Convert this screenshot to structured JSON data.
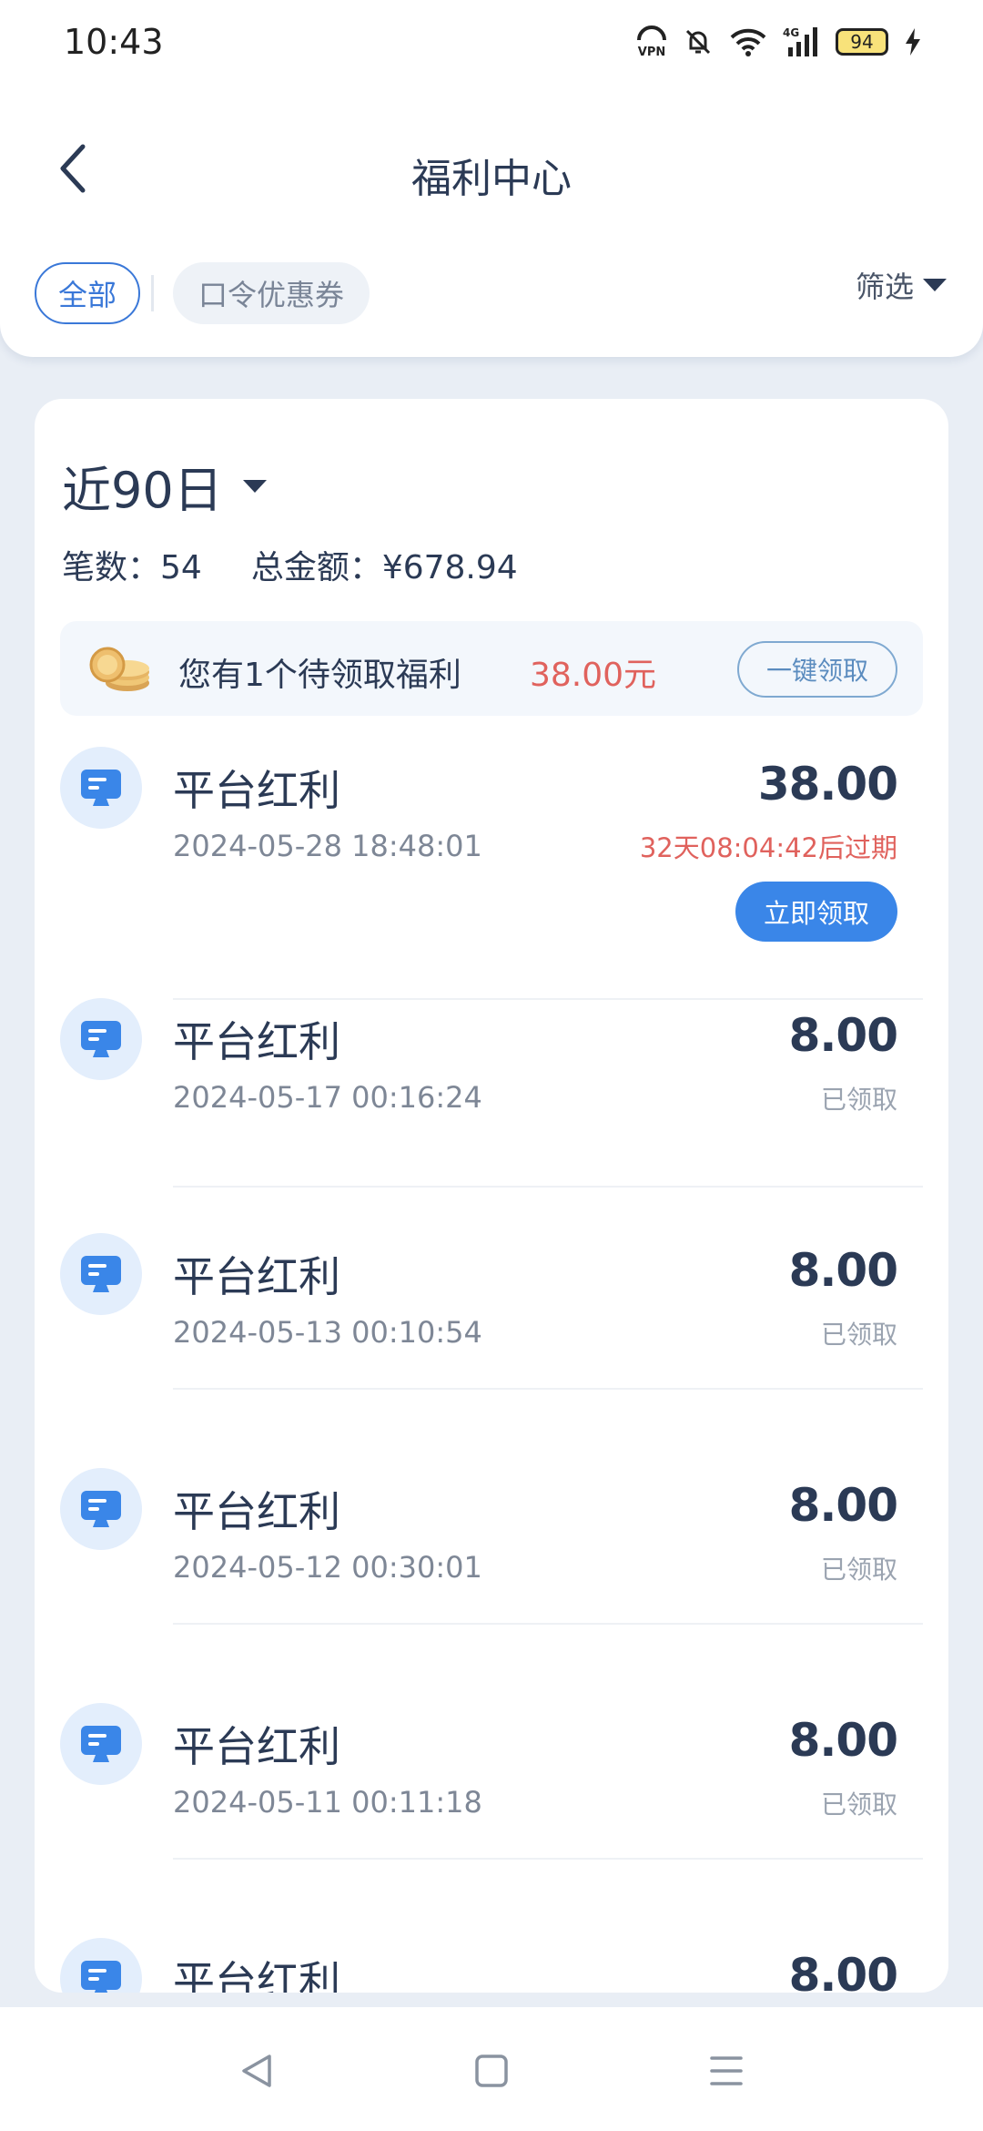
{
  "status_bar": {
    "time": "10:43",
    "battery": "94",
    "network": "4G",
    "icons": [
      "vpn-icon",
      "bell-off-icon",
      "wifi-icon",
      "signal-icon",
      "battery-icon",
      "charging-icon"
    ]
  },
  "header": {
    "title": "福利中心",
    "back_icon": "chevron-left-icon"
  },
  "filters": {
    "chips": [
      "全部",
      "口令优惠券"
    ],
    "active_chip": "全部",
    "filter_label": "筛选"
  },
  "summary": {
    "range": "近90日",
    "count_label": "笔数：54",
    "total_label": "总金额：¥678.94"
  },
  "banner": {
    "text": "您有1个待领取福利",
    "amount": "38.00元",
    "button": "一键领取"
  },
  "records": [
    {
      "title": "平台红利",
      "date": "2024-05-28 18:48:01",
      "amount": "38.00",
      "expire": "32天08:04:42后过期",
      "action": "立即领取"
    },
    {
      "title": "平台红利",
      "date": "2024-05-17 00:16:24",
      "amount": "8.00",
      "status": "已领取"
    },
    {
      "title": "平台红利",
      "date": "2024-05-13 00:10:54",
      "amount": "8.00",
      "status": "已领取"
    },
    {
      "title": "平台红利",
      "date": "2024-05-12 00:30:01",
      "amount": "8.00",
      "status": "已领取"
    },
    {
      "title": "平台红利",
      "date": "2024-05-11 00:11:18",
      "amount": "8.00",
      "status": "已领取"
    },
    {
      "title": "平台红利",
      "date": "",
      "amount": "8.00",
      "status": ""
    }
  ],
  "colors": {
    "accent": "#3a86e8",
    "highlight_red": "#e0625d",
    "text_primary": "#2b3a55",
    "background": "#e9eef5"
  },
  "navbar": {
    "buttons": [
      "back-nav-icon",
      "home-nav-icon",
      "menu-nav-icon"
    ]
  }
}
